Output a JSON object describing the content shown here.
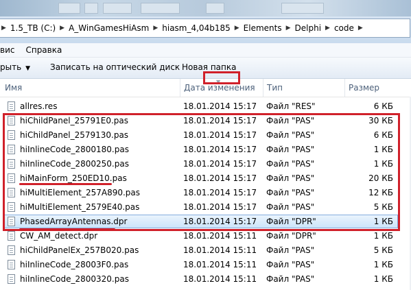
{
  "address": {
    "crumbs": [
      "1.5_TB (C:)",
      "A_WinGamesHiAsm",
      "hiasm_4,04b185",
      "Elements",
      "Delphi",
      "code"
    ]
  },
  "menu": {
    "items": [
      "вис",
      "Справка"
    ]
  },
  "toolbar": {
    "open_label": "рыть",
    "burn_label": "Записать на оптический диск",
    "new_folder_label": "Новая папка"
  },
  "columns": {
    "name": "Имя",
    "date": "Дата изменения",
    "type": "Тип",
    "size": "Размер"
  },
  "files": [
    {
      "name": "allres.res",
      "date": "18.01.2014 15:17",
      "type": "Файл \"RES\"",
      "size": "6 КБ"
    },
    {
      "name": "hiChildPanel_25791E0.pas",
      "date": "18.01.2014 15:17",
      "type": "Файл \"PAS\"",
      "size": "30 КБ"
    },
    {
      "name": "hiChildPanel_2579130.pas",
      "date": "18.01.2014 15:17",
      "type": "Файл \"PAS\"",
      "size": "6 КБ"
    },
    {
      "name": "hiInlineCode_2800180.pas",
      "date": "18.01.2014 15:17",
      "type": "Файл \"PAS\"",
      "size": "1 КБ"
    },
    {
      "name": "hiInlineCode_2800250.pas",
      "date": "18.01.2014 15:17",
      "type": "Файл \"PAS\"",
      "size": "1 КБ"
    },
    {
      "name": "hiMainForm_250ED10.pas",
      "date": "18.01.2014 15:17",
      "type": "Файл \"PAS\"",
      "size": "20 КБ"
    },
    {
      "name": "hiMultiElement_257A890.pas",
      "date": "18.01.2014 15:17",
      "type": "Файл \"PAS\"",
      "size": "12 КБ"
    },
    {
      "name": "hiMultiElement_2579E40.pas",
      "date": "18.01.2014 15:17",
      "type": "Файл \"PAS\"",
      "size": "5 КБ"
    },
    {
      "name": "PhasedArrayAntennas.dpr",
      "date": "18.01.2014 15:17",
      "type": "Файл \"DPR\"",
      "size": "1 КБ"
    },
    {
      "name": "CW_AM_detect.dpr",
      "date": "18.01.2014 15:11",
      "type": "Файл \"DPR\"",
      "size": "1 КБ"
    },
    {
      "name": "hiChildPanelEx_257B020.pas",
      "date": "18.01.2014 15:11",
      "type": "Файл \"PAS\"",
      "size": "5 КБ"
    },
    {
      "name": "hiInlineCode_28003F0.pas",
      "date": "18.01.2014 15:11",
      "type": "Файл \"PAS\"",
      "size": "1 КБ"
    },
    {
      "name": "hiInlineCode_2800320.pas",
      "date": "18.01.2014 15:11",
      "type": "Файл \"PAS\"",
      "size": "1 КБ"
    }
  ],
  "selected_index": 8,
  "colors": {
    "annotation_red": "#d0202a",
    "selection_border": "#84acdd"
  }
}
